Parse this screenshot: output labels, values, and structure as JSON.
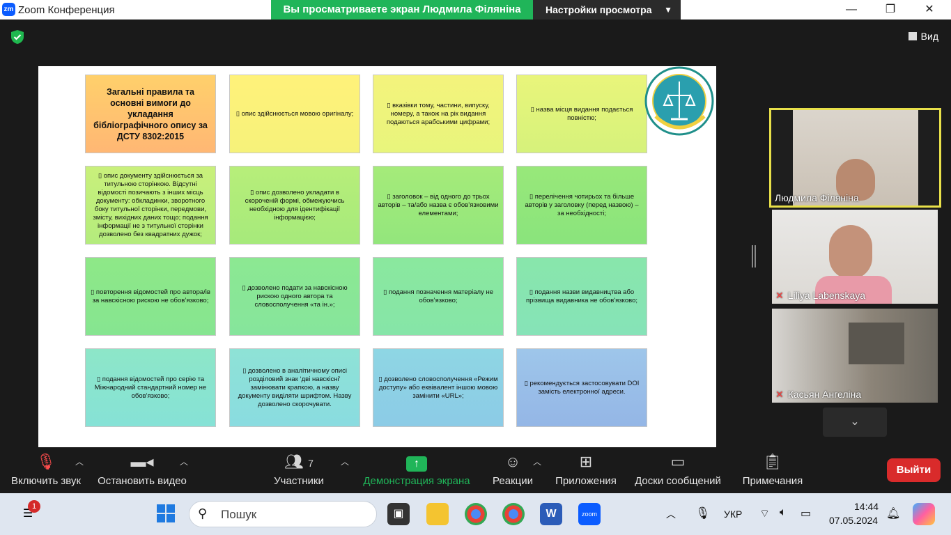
{
  "window": {
    "logo_text": "zm",
    "title": "Zoom Конференция",
    "share_banner": "Вы просматриваете экран Людмила Філяніна",
    "view_settings": "Настройки просмотра"
  },
  "meeting": {
    "view_label": "Вид"
  },
  "slide": {
    "cards": [
      "Загальні правила та основні вимоги до укладання бібліографічного опису за ДСТУ 8302:2015",
      "опис здійснюється мовою оригіналу;",
      "вказівки тому, частини, випуску, номеру, а також на рік видання подаються арабськими цифрами;",
      "назва місця видання подається повністю;",
      "опис документу здійснюється за титульною сторінкою. Відсутні відомості позичають з інших місць документу: обкладинки, зворотного боку титульної сторінки, передмови, змісту, вихідних даних тощо; подання інформації не з титульної сторінки дозволено без квадратних дужок;",
      "опис дозволено укладати в скороченій формі, обмежуючись необхідною для ідентифікації інформацією;",
      "заголовок – від одного до трьох авторів – та/або назва є обов’язковими елементами;",
      "перелічення чотирьох та більше авторів у заголовку (перед назвою) – за необхідності;",
      "повторення відомостей про автора/ів за навскісною рискою не обов’язково;",
      "дозволено подати за навскісною рискою одного автора та словосполучення «та ін.»;",
      "подання позначення матеріалу не обов’язково;",
      "подання назви видавництва або прізвища видавника не обов'язково;",
      "подання відомостей про серію та Міжнародний стандартний номер не обов'язково;",
      "дозволено в аналітичному описі розділовий знак ‘дві навскісні’ замінювати крапкою, а назву документу виділяти шрифтом. Назву дозволено скорочувати.",
      "дозволено словосполучення «Режим доступу» або еквівалент іншою мовою замінити «URL»;",
      "рекомендується застосовувати DOI замість електронної адреси."
    ],
    "bullet": "▯"
  },
  "participants": [
    {
      "name": "Людмила Філяніна",
      "muted": false,
      "active": true
    },
    {
      "name": "Liliya Labenskaya",
      "muted": true,
      "active": false
    },
    {
      "name": "Касьян Ангеліна",
      "muted": true,
      "active": false
    }
  ],
  "toolbar": {
    "unmute": "Включить звук",
    "stop_video": "Остановить видео",
    "participants": "Участники",
    "participants_count": "7",
    "share": "Демонстрация экрана",
    "reactions": "Реакции",
    "apps": "Приложения",
    "whiteboards": "Доски сообщений",
    "notes": "Примечания",
    "leave": "Выйти"
  },
  "taskbar": {
    "notification_count": "1",
    "search_placeholder": "Пошук",
    "language": "УКР",
    "time": "14:44",
    "date": "07.05.2024"
  },
  "colors": {
    "share_green": "#20b559",
    "leave_red": "#d92b2b",
    "active_speaker": "#e8e04a"
  }
}
